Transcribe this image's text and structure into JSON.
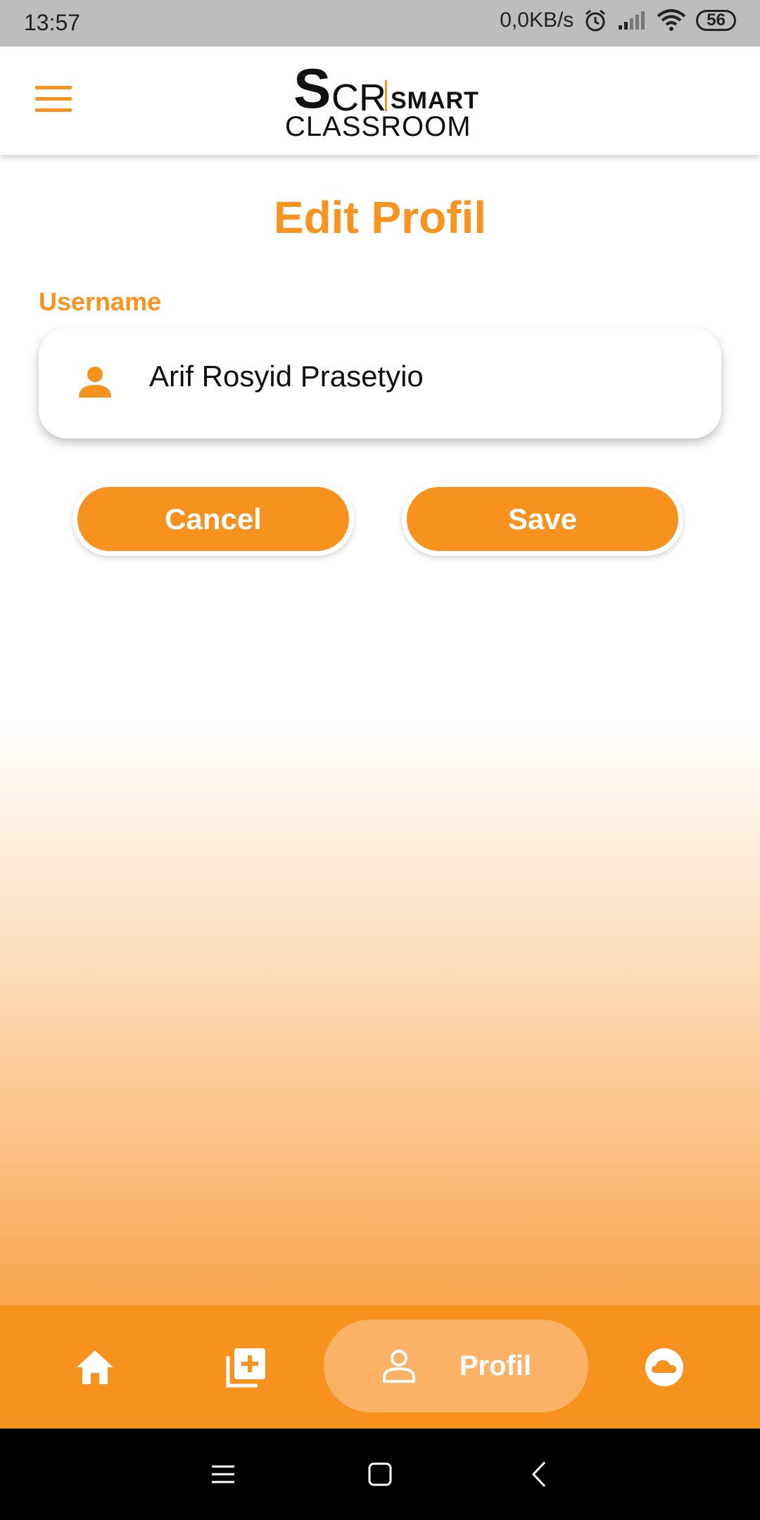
{
  "status_bar": {
    "time": "13:57",
    "network_speed": "0,0KB/s",
    "battery": "56",
    "icons": [
      "alarm-icon",
      "signal-icon",
      "wifi-icon",
      "battery-icon"
    ]
  },
  "app_bar": {
    "logo": {
      "big": "S",
      "cr": "CR",
      "smart": "SMART",
      "classroom": "CLASSROOM"
    },
    "menu_icon": "hamburger-icon"
  },
  "main": {
    "title": "Edit Profil",
    "username_label": "Username",
    "username_value": "Arif Rosyid Prasetyio",
    "cancel_label": "Cancel",
    "save_label": "Save"
  },
  "bottom_nav": {
    "items": [
      {
        "icon": "home-icon",
        "label": ""
      },
      {
        "icon": "add-library-icon",
        "label": ""
      },
      {
        "icon": "person-icon",
        "label": "Profil",
        "active": true
      },
      {
        "icon": "cloud-icon",
        "label": ""
      }
    ]
  },
  "colors": {
    "accent": "#f7921f",
    "accent_light": "#fbb267",
    "status_bar": "#bdbdbd"
  }
}
